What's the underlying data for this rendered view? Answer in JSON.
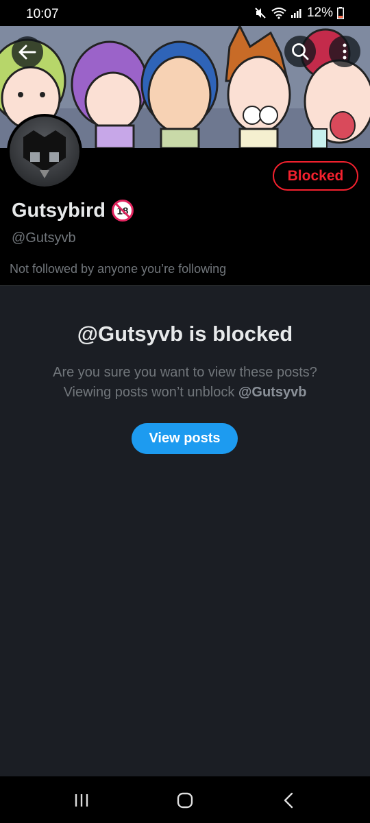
{
  "status_bar": {
    "time": "10:07",
    "battery": "12%",
    "icons": [
      "mute-icon",
      "wifi-icon",
      "signal-icon",
      "battery-icon"
    ]
  },
  "header": {
    "icons": [
      "back-arrow-icon",
      "search-icon",
      "more-vertical-icon"
    ]
  },
  "profile": {
    "display_name": "Gutsybird",
    "badge": "18",
    "handle": "@Gutsyvb",
    "followed_by": "Not followed by anyone you’re following",
    "blocked_label": "Blocked"
  },
  "blocked_notice": {
    "title": "@Gutsyvb is blocked",
    "line1": "Are you sure you want to view these posts?",
    "line2_prefix": "Viewing posts won’t unblock ",
    "line2_handle": "@Gutsyvb",
    "button_label": "View posts"
  },
  "colors": {
    "accent": "#1d9bf0",
    "blocked": "#f4212e",
    "panel_bg": "#1b1e24",
    "muted_text": "#71767b"
  },
  "nav_bar": {
    "icons": [
      "recent-apps-icon",
      "home-icon",
      "back-icon"
    ]
  }
}
